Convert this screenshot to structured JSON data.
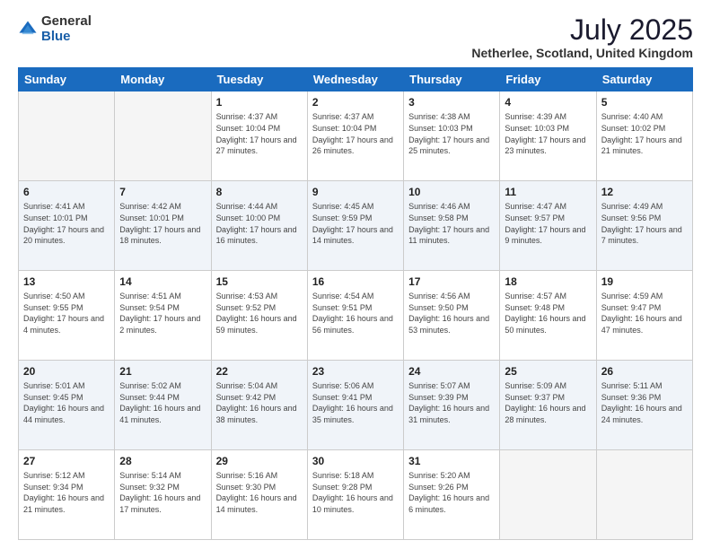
{
  "header": {
    "logo_general": "General",
    "logo_blue": "Blue",
    "month_year": "July 2025",
    "location": "Netherlee, Scotland, United Kingdom"
  },
  "days_of_week": [
    "Sunday",
    "Monday",
    "Tuesday",
    "Wednesday",
    "Thursday",
    "Friday",
    "Saturday"
  ],
  "weeks": [
    [
      {
        "day": "",
        "info": ""
      },
      {
        "day": "",
        "info": ""
      },
      {
        "day": "1",
        "info": "Sunrise: 4:37 AM\nSunset: 10:04 PM\nDaylight: 17 hours and 27 minutes."
      },
      {
        "day": "2",
        "info": "Sunrise: 4:37 AM\nSunset: 10:04 PM\nDaylight: 17 hours and 26 minutes."
      },
      {
        "day": "3",
        "info": "Sunrise: 4:38 AM\nSunset: 10:03 PM\nDaylight: 17 hours and 25 minutes."
      },
      {
        "day": "4",
        "info": "Sunrise: 4:39 AM\nSunset: 10:03 PM\nDaylight: 17 hours and 23 minutes."
      },
      {
        "day": "5",
        "info": "Sunrise: 4:40 AM\nSunset: 10:02 PM\nDaylight: 17 hours and 21 minutes."
      }
    ],
    [
      {
        "day": "6",
        "info": "Sunrise: 4:41 AM\nSunset: 10:01 PM\nDaylight: 17 hours and 20 minutes."
      },
      {
        "day": "7",
        "info": "Sunrise: 4:42 AM\nSunset: 10:01 PM\nDaylight: 17 hours and 18 minutes."
      },
      {
        "day": "8",
        "info": "Sunrise: 4:44 AM\nSunset: 10:00 PM\nDaylight: 17 hours and 16 minutes."
      },
      {
        "day": "9",
        "info": "Sunrise: 4:45 AM\nSunset: 9:59 PM\nDaylight: 17 hours and 14 minutes."
      },
      {
        "day": "10",
        "info": "Sunrise: 4:46 AM\nSunset: 9:58 PM\nDaylight: 17 hours and 11 minutes."
      },
      {
        "day": "11",
        "info": "Sunrise: 4:47 AM\nSunset: 9:57 PM\nDaylight: 17 hours and 9 minutes."
      },
      {
        "day": "12",
        "info": "Sunrise: 4:49 AM\nSunset: 9:56 PM\nDaylight: 17 hours and 7 minutes."
      }
    ],
    [
      {
        "day": "13",
        "info": "Sunrise: 4:50 AM\nSunset: 9:55 PM\nDaylight: 17 hours and 4 minutes."
      },
      {
        "day": "14",
        "info": "Sunrise: 4:51 AM\nSunset: 9:54 PM\nDaylight: 17 hours and 2 minutes."
      },
      {
        "day": "15",
        "info": "Sunrise: 4:53 AM\nSunset: 9:52 PM\nDaylight: 16 hours and 59 minutes."
      },
      {
        "day": "16",
        "info": "Sunrise: 4:54 AM\nSunset: 9:51 PM\nDaylight: 16 hours and 56 minutes."
      },
      {
        "day": "17",
        "info": "Sunrise: 4:56 AM\nSunset: 9:50 PM\nDaylight: 16 hours and 53 minutes."
      },
      {
        "day": "18",
        "info": "Sunrise: 4:57 AM\nSunset: 9:48 PM\nDaylight: 16 hours and 50 minutes."
      },
      {
        "day": "19",
        "info": "Sunrise: 4:59 AM\nSunset: 9:47 PM\nDaylight: 16 hours and 47 minutes."
      }
    ],
    [
      {
        "day": "20",
        "info": "Sunrise: 5:01 AM\nSunset: 9:45 PM\nDaylight: 16 hours and 44 minutes."
      },
      {
        "day": "21",
        "info": "Sunrise: 5:02 AM\nSunset: 9:44 PM\nDaylight: 16 hours and 41 minutes."
      },
      {
        "day": "22",
        "info": "Sunrise: 5:04 AM\nSunset: 9:42 PM\nDaylight: 16 hours and 38 minutes."
      },
      {
        "day": "23",
        "info": "Sunrise: 5:06 AM\nSunset: 9:41 PM\nDaylight: 16 hours and 35 minutes."
      },
      {
        "day": "24",
        "info": "Sunrise: 5:07 AM\nSunset: 9:39 PM\nDaylight: 16 hours and 31 minutes."
      },
      {
        "day": "25",
        "info": "Sunrise: 5:09 AM\nSunset: 9:37 PM\nDaylight: 16 hours and 28 minutes."
      },
      {
        "day": "26",
        "info": "Sunrise: 5:11 AM\nSunset: 9:36 PM\nDaylight: 16 hours and 24 minutes."
      }
    ],
    [
      {
        "day": "27",
        "info": "Sunrise: 5:12 AM\nSunset: 9:34 PM\nDaylight: 16 hours and 21 minutes."
      },
      {
        "day": "28",
        "info": "Sunrise: 5:14 AM\nSunset: 9:32 PM\nDaylight: 16 hours and 17 minutes."
      },
      {
        "day": "29",
        "info": "Sunrise: 5:16 AM\nSunset: 9:30 PM\nDaylight: 16 hours and 14 minutes."
      },
      {
        "day": "30",
        "info": "Sunrise: 5:18 AM\nSunset: 9:28 PM\nDaylight: 16 hours and 10 minutes."
      },
      {
        "day": "31",
        "info": "Sunrise: 5:20 AM\nSunset: 9:26 PM\nDaylight: 16 hours and 6 minutes."
      },
      {
        "day": "",
        "info": ""
      },
      {
        "day": "",
        "info": ""
      }
    ]
  ]
}
